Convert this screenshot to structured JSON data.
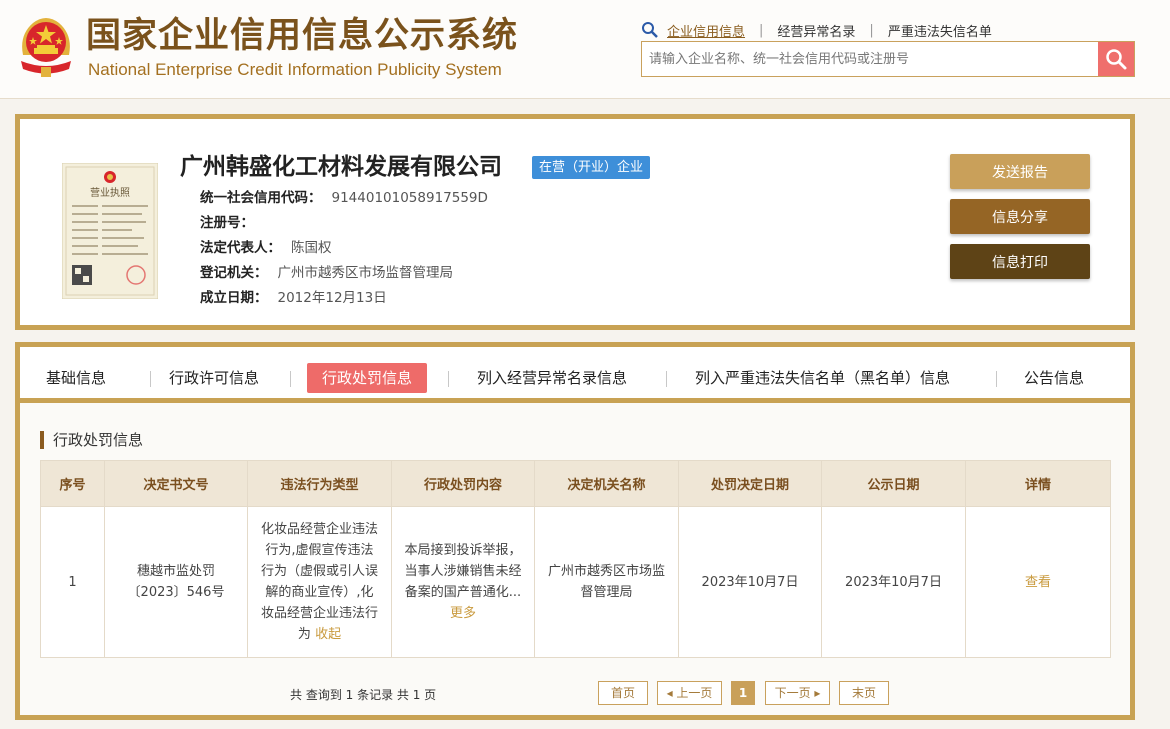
{
  "header": {
    "title": "国家企业信用信息公示系统",
    "subtitle": "National Enterprise Credit Information Publicity System",
    "nav": [
      {
        "label": "企业信用信息",
        "active": true
      },
      {
        "label": "经营异常名录",
        "active": false
      },
      {
        "label": "严重违法失信名单",
        "active": false
      }
    ],
    "search_placeholder": "请输入企业名称、统一社会信用代码或注册号"
  },
  "company": {
    "name": "广州韩盛化工材料发展有限公司",
    "status": "在营（开业）企业",
    "fields": [
      {
        "label": "统一社会信用代码：",
        "value": "91440101058917559D"
      },
      {
        "label": "注册号：",
        "value": ""
      },
      {
        "label": "法定代表人：",
        "value": "陈国权"
      },
      {
        "label": "登记机关：",
        "value": "广州市越秀区市场监督管理局"
      },
      {
        "label": "成立日期：",
        "value": "2012年12月13日"
      }
    ],
    "actions": {
      "report": "发送报告",
      "share": "信息分享",
      "print": "信息打印"
    },
    "license_label": "营业执照"
  },
  "tabs": [
    {
      "label": "基础信息"
    },
    {
      "label": "行政许可信息"
    },
    {
      "label": "行政处罚信息",
      "active": true
    },
    {
      "label": "列入经营异常名录信息"
    },
    {
      "label": "列入严重违法失信名单（黑名单）信息"
    },
    {
      "label": "公告信息"
    }
  ],
  "section": {
    "title": "行政处罚信息",
    "columns": [
      "序号",
      "决定书文号",
      "违法行为类型",
      "行政处罚内容",
      "决定机关名称",
      "处罚决定日期",
      "公示日期",
      "详情"
    ],
    "rows": [
      {
        "index": "1",
        "doc_no": "穗越市监处罚〔2023〕546号",
        "violation": "化妆品经营企业违法行为,虚假宣传违法行为（虚假或引人误解的商业宣传）,化妆品经营企业违法行为",
        "violation_toggle": "收起",
        "content": "本局接到投诉举报，当事人涉嫌销售未经备案的国产普通化...",
        "content_more": "更多",
        "authority": "广州市越秀区市场监督管理局",
        "decision_date": "2023年10月7日",
        "publish_date": "2023年10月7日",
        "detail": "查看"
      }
    ],
    "summary": "共 查询到 1 条记录 共 1 页",
    "pager": {
      "first": "首页",
      "prev": "上一页",
      "current": "1",
      "next": "下一页",
      "last": "末页"
    }
  },
  "colors": {
    "gold_border": "#c8a254",
    "brand_brown": "#7a521c",
    "active_tab": "#ee6b69",
    "status_blue": "#3e8fd9",
    "search_red": "#ef6f6c"
  }
}
